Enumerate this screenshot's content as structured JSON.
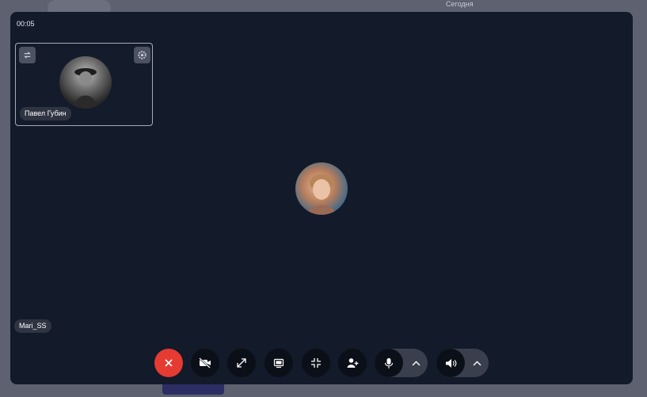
{
  "call": {
    "timer": "00:05",
    "self_name": "Павел Губин",
    "remote_name": "Mari_SS"
  },
  "background": {
    "header_text": "Сегодня"
  },
  "controls": [
    {
      "name": "hang-up",
      "icon": "close-icon",
      "color": "#e63b32"
    },
    {
      "name": "camera-toggle",
      "icon": "video-off-icon"
    },
    {
      "name": "fullscreen",
      "icon": "expand-icon"
    },
    {
      "name": "screen-share",
      "icon": "screen-icon"
    },
    {
      "name": "minimize",
      "icon": "collapse-icon"
    },
    {
      "name": "add-participant",
      "icon": "add-user-icon"
    },
    {
      "name": "microphone",
      "icon": "microphone-icon",
      "menu_icon": "chevron-up-icon"
    },
    {
      "name": "speaker",
      "icon": "speaker-icon",
      "menu_icon": "chevron-up-icon"
    }
  ],
  "colors": {
    "call_background": "#131a2a",
    "hangup": "#e63b32",
    "control": "#0b0f18"
  }
}
